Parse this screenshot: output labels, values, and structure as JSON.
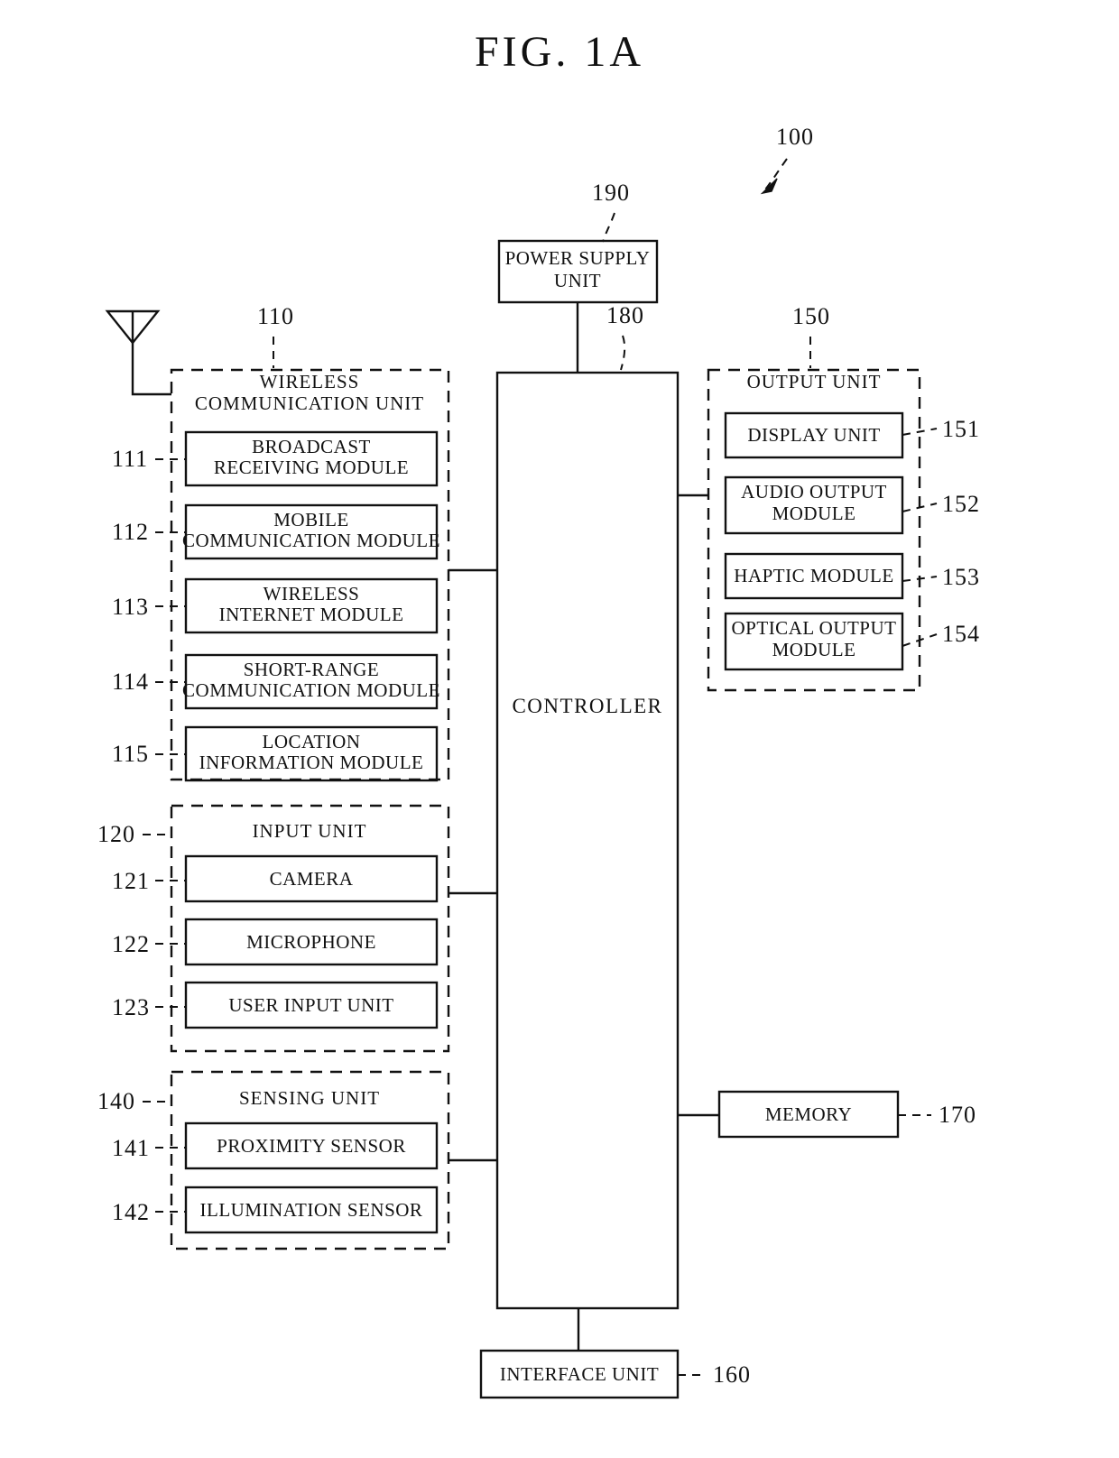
{
  "figure": {
    "title": "FIG.  1A",
    "device_ref": "100"
  },
  "top": {
    "power_supply": {
      "label_line1": "POWER SUPPLY",
      "label_line2": "UNIT",
      "ref": "190"
    },
    "controller": {
      "label": "CONTROLLER",
      "ref": "180"
    }
  },
  "left_column": {
    "wireless_unit": {
      "title_line1": "WIRELESS",
      "title_line2": "COMMUNICATION UNIT",
      "ref": "110",
      "modules": [
        {
          "ref": "111",
          "line1": "BROADCAST",
          "line2": "RECEIVING MODULE"
        },
        {
          "ref": "112",
          "line1": "MOBILE",
          "line2": "COMMUNICATION MODULE"
        },
        {
          "ref": "113",
          "line1": "WIRELESS",
          "line2": "INTERNET MODULE"
        },
        {
          "ref": "114",
          "line1": "SHORT-RANGE",
          "line2": "COMMUNICATION MODULE"
        },
        {
          "ref": "115",
          "line1": "LOCATION",
          "line2": "INFORMATION MODULE"
        }
      ]
    },
    "input_unit": {
      "title": "INPUT UNIT",
      "ref": "120",
      "modules": [
        {
          "ref": "121",
          "label": "CAMERA"
        },
        {
          "ref": "122",
          "label": "MICROPHONE"
        },
        {
          "ref": "123",
          "label": "USER INPUT UNIT"
        }
      ]
    },
    "sensing_unit": {
      "title": "SENSING UNIT",
      "ref": "140",
      "modules": [
        {
          "ref": "141",
          "label": "PROXIMITY SENSOR"
        },
        {
          "ref": "142",
          "label": "ILLUMINATION SENSOR"
        }
      ]
    }
  },
  "right_column": {
    "output_unit": {
      "title": "OUTPUT UNIT",
      "ref": "150",
      "modules": [
        {
          "ref": "151",
          "line1": "DISPLAY UNIT",
          "line2": ""
        },
        {
          "ref": "152",
          "line1": "AUDIO OUTPUT",
          "line2": "MODULE"
        },
        {
          "ref": "153",
          "line1": "HAPTIC MODULE",
          "line2": ""
        },
        {
          "ref": "154",
          "line1": "OPTICAL OUTPUT",
          "line2": "MODULE"
        }
      ]
    },
    "memory": {
      "label": "MEMORY",
      "ref": "170"
    }
  },
  "bottom": {
    "interface_unit": {
      "label": "INTERFACE UNIT",
      "ref": "160"
    }
  },
  "icons": {
    "antenna": "antenna-icon"
  },
  "colors": {
    "ink": "#111111",
    "paper": "#ffffff"
  }
}
